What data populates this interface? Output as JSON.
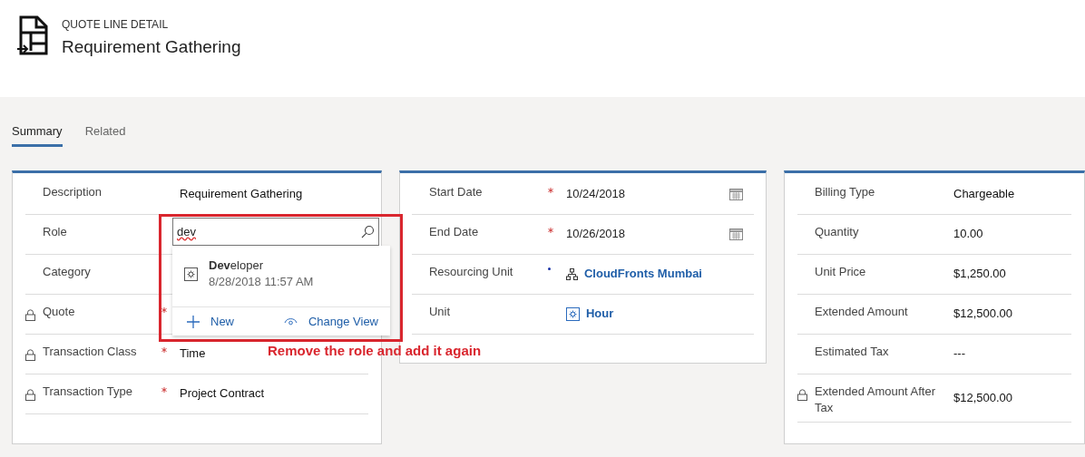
{
  "header": {
    "entity": "QUOTE LINE DETAIL",
    "title": "Requirement Gathering"
  },
  "tabs": [
    {
      "label": "Summary",
      "selected": true
    },
    {
      "label": "Related",
      "selected": false
    }
  ],
  "sections": [
    {
      "fields": [
        {
          "label": "Description",
          "value": "Requirement Gathering",
          "kind": "text",
          "locked": false,
          "required": false,
          "recommended": false
        },
        {
          "label": "Role",
          "locked": false,
          "required": false,
          "recommended": false
        },
        {
          "label": "Category",
          "locked": false,
          "required": false,
          "recommended": false
        },
        {
          "label": "Quote",
          "locked": true,
          "required": true,
          "recommended": false
        },
        {
          "label": "Transaction Class",
          "value": "Time",
          "kind": "text",
          "locked": true,
          "required": true,
          "recommended": false
        },
        {
          "label": "Transaction Type",
          "value": "Project Contract",
          "kind": "text",
          "locked": true,
          "required": true,
          "recommended": false
        }
      ]
    },
    {
      "fields": [
        {
          "label": "Start Date",
          "value": "10/24/2018",
          "kind": "date",
          "locked": false,
          "required": true,
          "recommended": false
        },
        {
          "label": "End Date",
          "value": "10/26/2018",
          "kind": "date",
          "locked": false,
          "required": true,
          "recommended": false
        },
        {
          "label": "Resourcing Unit",
          "value": "CloudFronts Mumbai",
          "kind": "org",
          "locked": false,
          "required": false,
          "recommended": true
        },
        {
          "label": "Unit",
          "value": "Hour",
          "kind": "unit",
          "locked": false,
          "required": false,
          "recommended": false
        }
      ]
    },
    {
      "fields": [
        {
          "label": "Billing Type",
          "value": "Chargeable",
          "kind": "text",
          "locked": false,
          "required": false,
          "recommended": false
        },
        {
          "label": "Quantity",
          "value": "10.00",
          "kind": "text",
          "locked": false,
          "required": false,
          "recommended": false
        },
        {
          "label": "Unit Price",
          "value": "$1,250.00",
          "kind": "text",
          "locked": false,
          "required": false,
          "recommended": false
        },
        {
          "label": "Extended Amount",
          "value": "$12,500.00",
          "kind": "text",
          "locked": false,
          "required": false,
          "recommended": false
        },
        {
          "label": "Estimated Tax",
          "value": "---",
          "kind": "text",
          "locked": false,
          "required": false,
          "recommended": false
        },
        {
          "label": "Extended Amount After Tax",
          "value": "$12,500.00",
          "kind": "text",
          "locked": true,
          "required": false,
          "recommended": false
        }
      ]
    }
  ],
  "lookup": {
    "query": "dev",
    "results": [
      {
        "name": "**Dev**eloper",
        "date": "8/28/2018 11:57 AM"
      }
    ],
    "actions": [
      {
        "label": "New",
        "kind": "new"
      },
      {
        "label": "Change View",
        "kind": "view"
      }
    ]
  },
  "annotation": "Remove the role and add it again"
}
